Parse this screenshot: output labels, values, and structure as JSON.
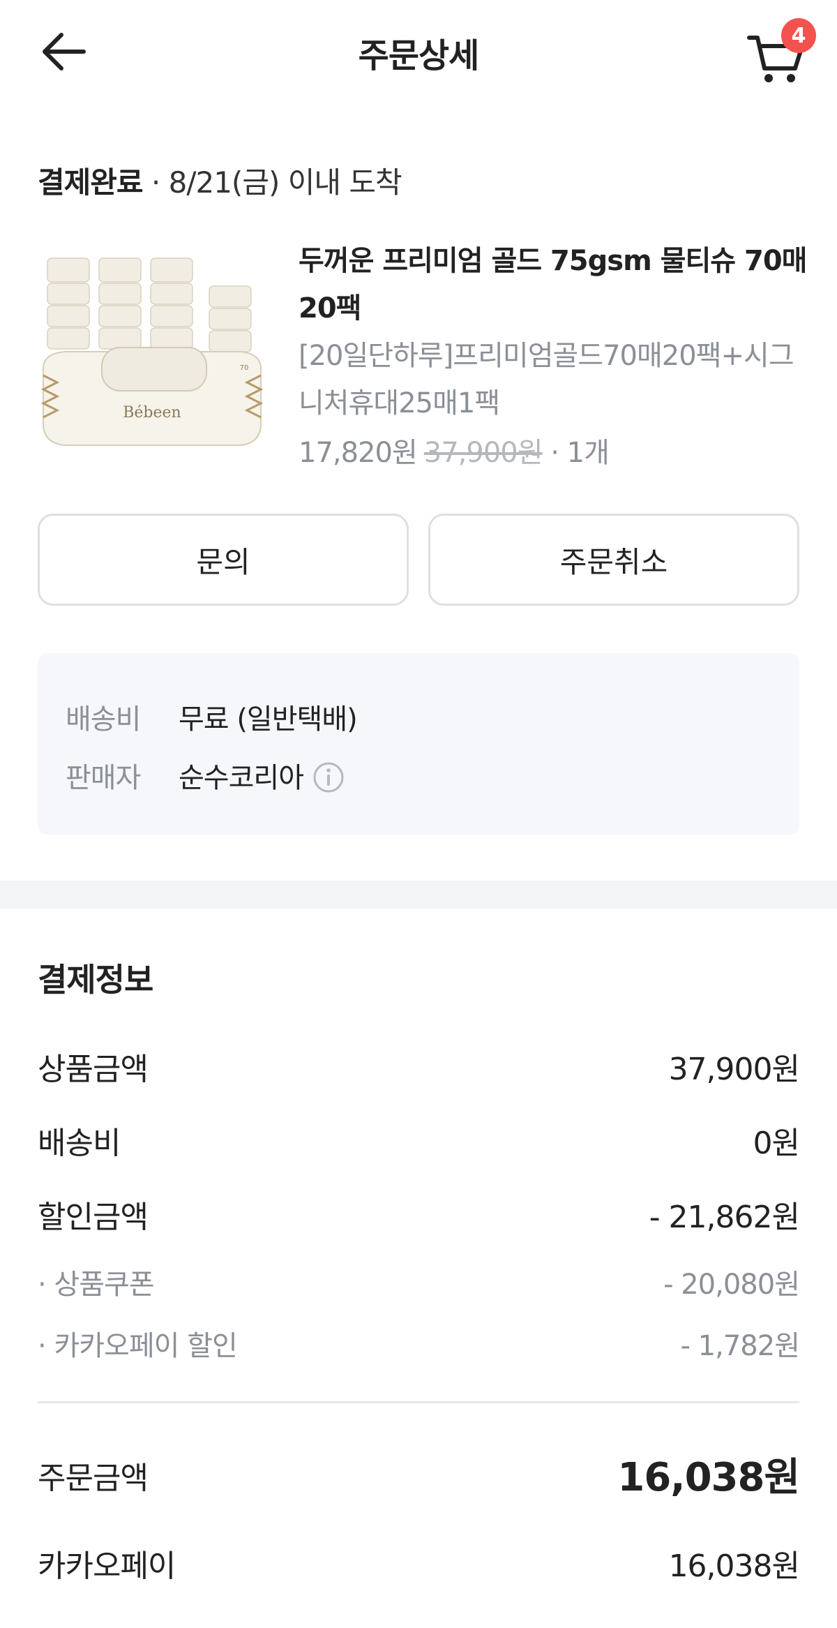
{
  "header": {
    "title": "주문상세",
    "cart_count": "4"
  },
  "status": {
    "state": "결제완료",
    "arrival": " · 8/21(금) 이내 도착"
  },
  "product": {
    "name": "두꺼운 프리미엄 골드 75gsm 물티슈 70매 20팩",
    "option": "[20일단하루]프리미엄골드70매20팩+시그니처휴대25매1팩",
    "price": "17,820원",
    "original_price": "37,900원",
    "quantity": " · 1개",
    "image_brand": "Bébeen",
    "image_count": "70"
  },
  "actions": {
    "inquiry": "문의",
    "cancel": "주문취소"
  },
  "shipping": {
    "fee_label": "배송비",
    "fee_value": "무료 (일반택배)",
    "seller_label": "판매자",
    "seller_value": "순수코리아"
  },
  "payment": {
    "title": "결제정보",
    "rows": [
      {
        "label": "상품금액",
        "value": "37,900원"
      },
      {
        "label": "배송비",
        "value": "0원"
      },
      {
        "label": "할인금액",
        "value": "- 21,862원"
      },
      {
        "label": "· 상품쿠폰",
        "value": "- 20,080원"
      },
      {
        "label": "· 카카오페이 할인",
        "value": "- 1,782원"
      }
    ],
    "total_label": "주문금액",
    "total_value": "16,038원",
    "method_label": "카카오페이",
    "method_value": "16,038원"
  },
  "colors": {
    "badge": "#f5524f",
    "muted_text": "#8b8f96",
    "box_bg": "#f5f7fa"
  }
}
